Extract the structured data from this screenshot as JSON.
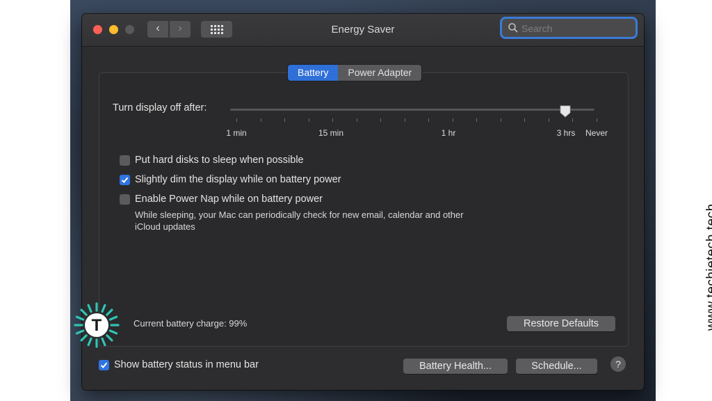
{
  "window": {
    "title": "Energy Saver"
  },
  "toolbar": {
    "back_icon": "chevron-left-icon",
    "forward_icon": "chevron-right-icon",
    "grid_icon": "grid-icon",
    "search_placeholder": "Search"
  },
  "tabs": [
    {
      "label": "Battery",
      "active": true
    },
    {
      "label": "Power Adapter",
      "active": false
    }
  ],
  "display_off": {
    "label": "Turn display off after:",
    "selected": "3 hrs",
    "ticks": [
      "1 min",
      "15 min",
      "1 hr",
      "3 hrs",
      "Never"
    ]
  },
  "options": [
    {
      "label": "Put hard disks to sleep when possible",
      "checked": false
    },
    {
      "label": "Slightly dim the display while on battery power",
      "checked": true
    },
    {
      "label": "Enable Power Nap while on battery power",
      "checked": false
    }
  ],
  "power_nap_note": {
    "line1": "While sleeping, your Mac can periodically check for new email, calendar and other",
    "line2": "iCloud updates"
  },
  "battery": {
    "charge_text": "Current battery charge: 99%"
  },
  "buttons": {
    "restore_defaults": "Restore Defaults",
    "battery_health": "Battery Health...",
    "schedule": "Schedule...",
    "help": "?"
  },
  "menu_bar": {
    "label": "Show battery status in menu bar",
    "checked": true
  },
  "watermark": {
    "text": "www.techietech.tech",
    "logo_letter": "T"
  },
  "colors": {
    "accent": "#2f74e0",
    "window_bg": "#2d2d2f",
    "logo": "#2ec4b6"
  }
}
